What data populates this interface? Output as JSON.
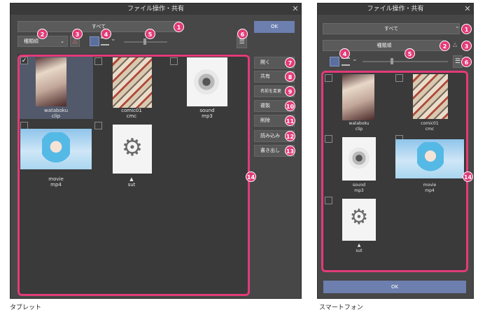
{
  "tablet": {
    "title": "ファイル操作・共有",
    "filter_value": "すべて",
    "type_value": "種類順",
    "ok_label": "OK",
    "side_buttons": [
      "開く",
      "共有",
      "名前を変更",
      "複製",
      "削除",
      "読み込み",
      "書き出し"
    ],
    "files": [
      {
        "name": "wataboku",
        "ext": "clip"
      },
      {
        "name": "comic01",
        "ext": "cmc"
      },
      {
        "name": "sound",
        "ext": "mp3"
      },
      {
        "name": "movie",
        "ext": "mp4"
      },
      {
        "name": "▲",
        "ext": "sut"
      }
    ],
    "caption": "タブレット"
  },
  "phone": {
    "title": "ファイル操作・共有",
    "filter_value": "すべて",
    "type_value": "種類順",
    "ok_label": "OK",
    "files": [
      {
        "name": "wataboku",
        "ext": "clip"
      },
      {
        "name": "comic01",
        "ext": "cmc"
      },
      {
        "name": "sound",
        "ext": "mp3"
      },
      {
        "name": "movie",
        "ext": "mp4"
      },
      {
        "name": "▲",
        "ext": "sut"
      }
    ],
    "caption": "スマートフォン"
  },
  "badges": [
    "1",
    "2",
    "3",
    "4",
    "5",
    "6",
    "7",
    "8",
    "9",
    "10",
    "11",
    "12",
    "13",
    "14"
  ],
  "colors": {
    "accent": "#e23b78",
    "ok": "#6c7fae",
    "panel": "#474747",
    "grid": "#3a3a3a"
  },
  "icons": [
    "close-icon",
    "chevron-down-icon",
    "warning-icon",
    "thumbnail-view-icon",
    "list-view-icon",
    "menu-icon",
    "speaker-icon",
    "gear-icon"
  ]
}
